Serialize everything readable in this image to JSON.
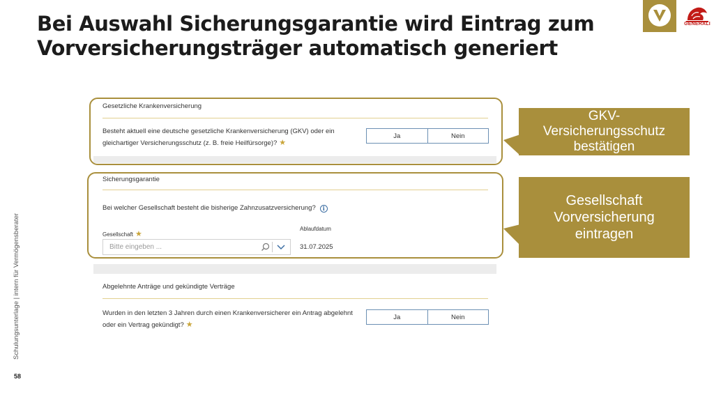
{
  "slide": {
    "title_line1": "Bei Auswahl Sicherungsgarantie wird Eintrag zum",
    "title_line2": "Vorversicherungsträger automatisch generiert",
    "side_text": "Schulungsunterlage | intern für Vermögensberater",
    "page_number": "58",
    "brand_text": "GENERALI"
  },
  "gkv": {
    "section_title": "Gesetzliche Krankenversicherung",
    "question_line1": "Besteht aktuell eine deutsche gesetzliche Krankenversicherung (GKV) oder ein",
    "question_line2": "gleichartiger Versicherungsschutz (z. B. freie Heilfürsorge)?",
    "option_yes": "Ja",
    "option_no": "Nein"
  },
  "sicherung": {
    "section_title": "Sicherungsgarantie",
    "question": "Bei welcher Gesellschaft besteht die bisherige Zahnzusatzversicherung?",
    "field_company_label": "Gesellschaft",
    "field_company_placeholder": "Bitte eingeben ...",
    "field_date_label": "Ablaufdatum",
    "field_date_value": "31.07.2025"
  },
  "abgelehnt": {
    "section_title": "Abgelehnte Anträge und gekündigte Verträge",
    "question_line1": "Wurden in den letzten 3 Jahren durch einen Krankenversicherer ein Antrag abgelehnt",
    "question_line2": "oder ein Vertrag gekündigt?",
    "option_yes": "Ja",
    "option_no": "Nein"
  },
  "callouts": {
    "gkv_line1": "GKV-",
    "gkv_line2": "Versicherungsschutz",
    "gkv_line3": "bestätigen",
    "company_line1": "Gesellschaft",
    "company_line2": "Vorversicherung",
    "company_line3": "eintragen"
  },
  "colors": {
    "accent_gold": "#a98f3c",
    "divider_gold": "#e2cf8f",
    "toggle_border": "#6b8fb3",
    "generali_red": "#c21b17"
  },
  "icons": [
    "dvag-logo-icon",
    "generali-lion-icon",
    "info-icon",
    "search-icon",
    "chevron-down-icon",
    "required-star-icon"
  ]
}
